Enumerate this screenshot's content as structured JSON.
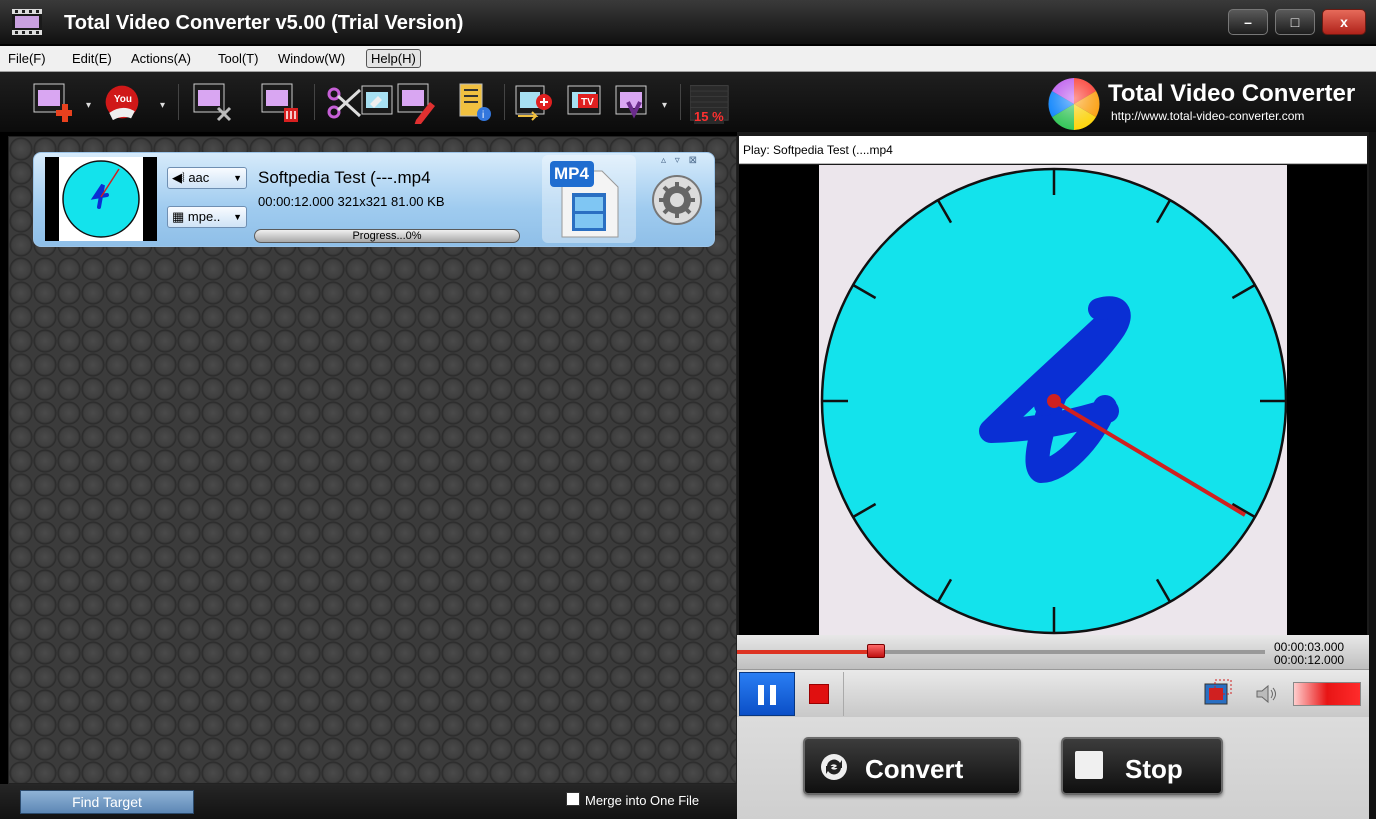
{
  "window": {
    "title": "Total Video Converter v5.00 (Trial Version)",
    "minimize": "–",
    "maximize": "□",
    "close": "x"
  },
  "menu": [
    {
      "label": "File(F)"
    },
    {
      "label": "Edit(E)"
    },
    {
      "label": "Actions(A)"
    },
    {
      "label": "Tool(T)"
    },
    {
      "label": "Window(W)"
    },
    {
      "label": "Help(H)"
    }
  ],
  "toolbar": {
    "icons": [
      "add-file-icon",
      "youtube-download-icon",
      "cut-video-icon",
      "delete-file-icon",
      "scissors-icon",
      "edit-video-icon",
      "file-info-icon",
      "insert-clip-icon",
      "tv-icon",
      "dvd-menu-icon",
      "cpu-usage-icon"
    ],
    "cpu_label": "15 %"
  },
  "brand": {
    "name": "Total Video Converter",
    "url": "http://www.total-video-converter.com"
  },
  "file_item": {
    "audio_codec": "aac",
    "video_codec": "mpe..",
    "name": "Softpedia Test (---.mp4",
    "info": "00:00:12.000 321x321 81.00 KB",
    "progress_text": "Progress...0%",
    "progress": 0,
    "format": "MP4",
    "card_controls": "▵ ▿ ⊠"
  },
  "bottom_bar": {
    "find_target": "Find Target",
    "merge_label": "Merge into One File",
    "merge_checked": false
  },
  "player": {
    "play_label": "Play: Softpedia Test (....mp4",
    "time_current": "00:00:03.000",
    "time_total": "00:00:12.000",
    "seek_fraction": 0.25,
    "volume": 1.0
  },
  "actions": {
    "convert": "Convert",
    "stop": "Stop"
  },
  "colors": {
    "clock_face": "#13e3ec",
    "digit": "#0a2fd4",
    "second_hand": "#d02020",
    "accent_blue": "#0b4fc7"
  }
}
